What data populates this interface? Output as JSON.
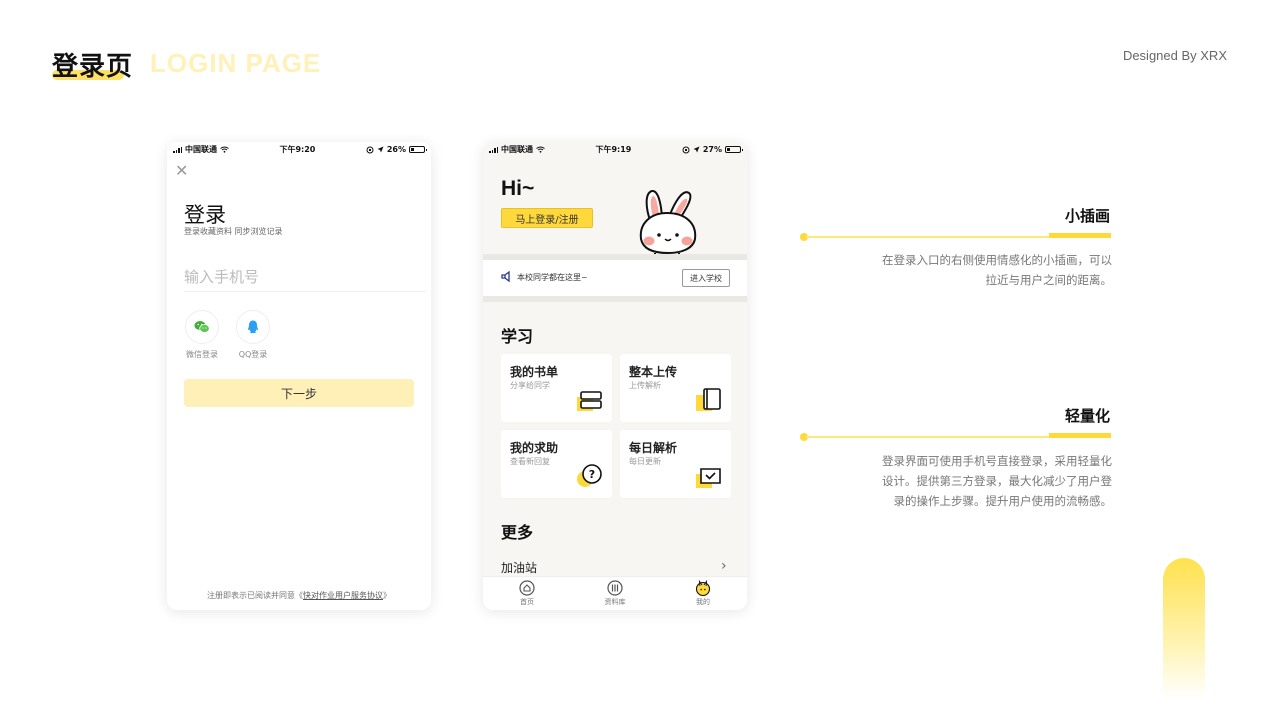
{
  "header": {
    "title_cn": "登录页",
    "title_en": "LOGIN PAGE",
    "designer": "Designed By XRX"
  },
  "colors": {
    "accent": "#ffd93b",
    "accent_light": "#fff0b8"
  },
  "phone1": {
    "status": {
      "carrier": "中国联通",
      "time": "下午9:20",
      "battery": "26%",
      "battery_level": 0.26
    },
    "close_icon": "close-icon",
    "title": "登录",
    "subtitle": "登录收藏资料 同步浏览记录",
    "phone_placeholder": "输入手机号",
    "wechat_label": "微信登录",
    "qq_label": "QQ登录",
    "next_label": "下一步",
    "terms_prefix": "注册即表示已阅读并同意《",
    "terms_link": "快对作业用户服务协议",
    "terms_suffix": "》"
  },
  "phone2": {
    "status": {
      "carrier": "中国联通",
      "time": "下午9:19",
      "battery": "27%",
      "battery_level": 0.27
    },
    "greeting": "Hi~",
    "login_button": "马上登录/注册",
    "notice": "本校同学都在这里~",
    "enter_school": "进入学校",
    "section_study": "学习",
    "cards": [
      {
        "title": "我的书单",
        "sub": "分享给同学"
      },
      {
        "title": "整本上传",
        "sub": "上传解析"
      },
      {
        "title": "我的求助",
        "sub": "查看新回复"
      },
      {
        "title": "每日解析",
        "sub": "每日更新"
      }
    ],
    "section_more": "更多",
    "more_item": "加油站",
    "tabs": [
      {
        "label": "首页"
      },
      {
        "label": "资料库"
      },
      {
        "label": "我的"
      }
    ]
  },
  "annotations": [
    {
      "title": "小插画",
      "desc_line1": "在登录入口的右侧使用情感化的小插画，可以",
      "desc_line2": "拉近与用户之间的距离。"
    },
    {
      "title": "轻量化",
      "desc_line1": "登录界面可使用手机号直接登录，采用轻量化",
      "desc_line2": "设计。提供第三方登录，最大化减少了用户登",
      "desc_line3": "录的操作上步骤。提升用户使用的流畅感。"
    }
  ]
}
